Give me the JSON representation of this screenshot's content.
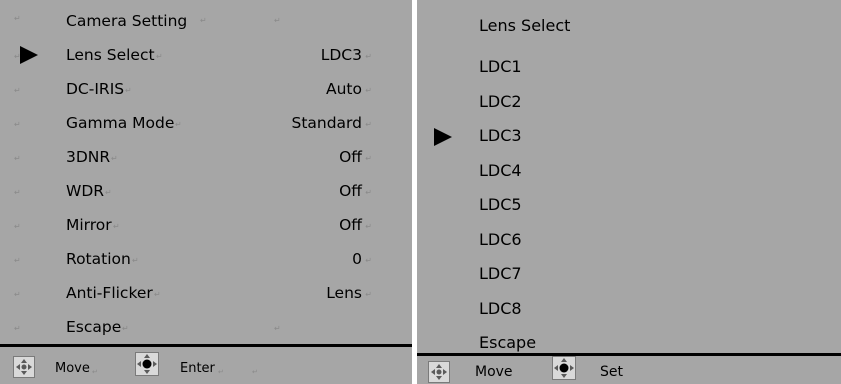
{
  "camera_menu": {
    "title": "Camera Setting",
    "items": [
      {
        "label": "Lens Select",
        "value": "LDC3",
        "selected": true
      },
      {
        "label": "DC-IRIS",
        "value": "Auto"
      },
      {
        "label": "Gamma Mode",
        "value": "Standard"
      },
      {
        "label": "3DNR",
        "value": "Off"
      },
      {
        "label": "WDR",
        "value": "Off"
      },
      {
        "label": "Mirror",
        "value": "Off"
      },
      {
        "label": "Rotation",
        "value": "0"
      },
      {
        "label": "Anti-Flicker",
        "value": "Lens"
      },
      {
        "label": "Escape",
        "value": ""
      }
    ],
    "footer": {
      "move_label": "Move",
      "enter_label": "Enter"
    }
  },
  "lens_menu": {
    "title": "Lens Select",
    "options": [
      "LDC1",
      "LDC2",
      "LDC3",
      "LDC4",
      "LDC5",
      "LDC6",
      "LDC7",
      "LDC8",
      "Escape"
    ],
    "selected_index": 2,
    "footer": {
      "move_label": "Move",
      "set_label": "Set"
    }
  },
  "icons": {
    "cursor": "triangle-right-icon",
    "move": "up-down-joystick-icon",
    "enter": "joystick-press-icon",
    "return_mark": "paragraph-return-mark-icon"
  }
}
